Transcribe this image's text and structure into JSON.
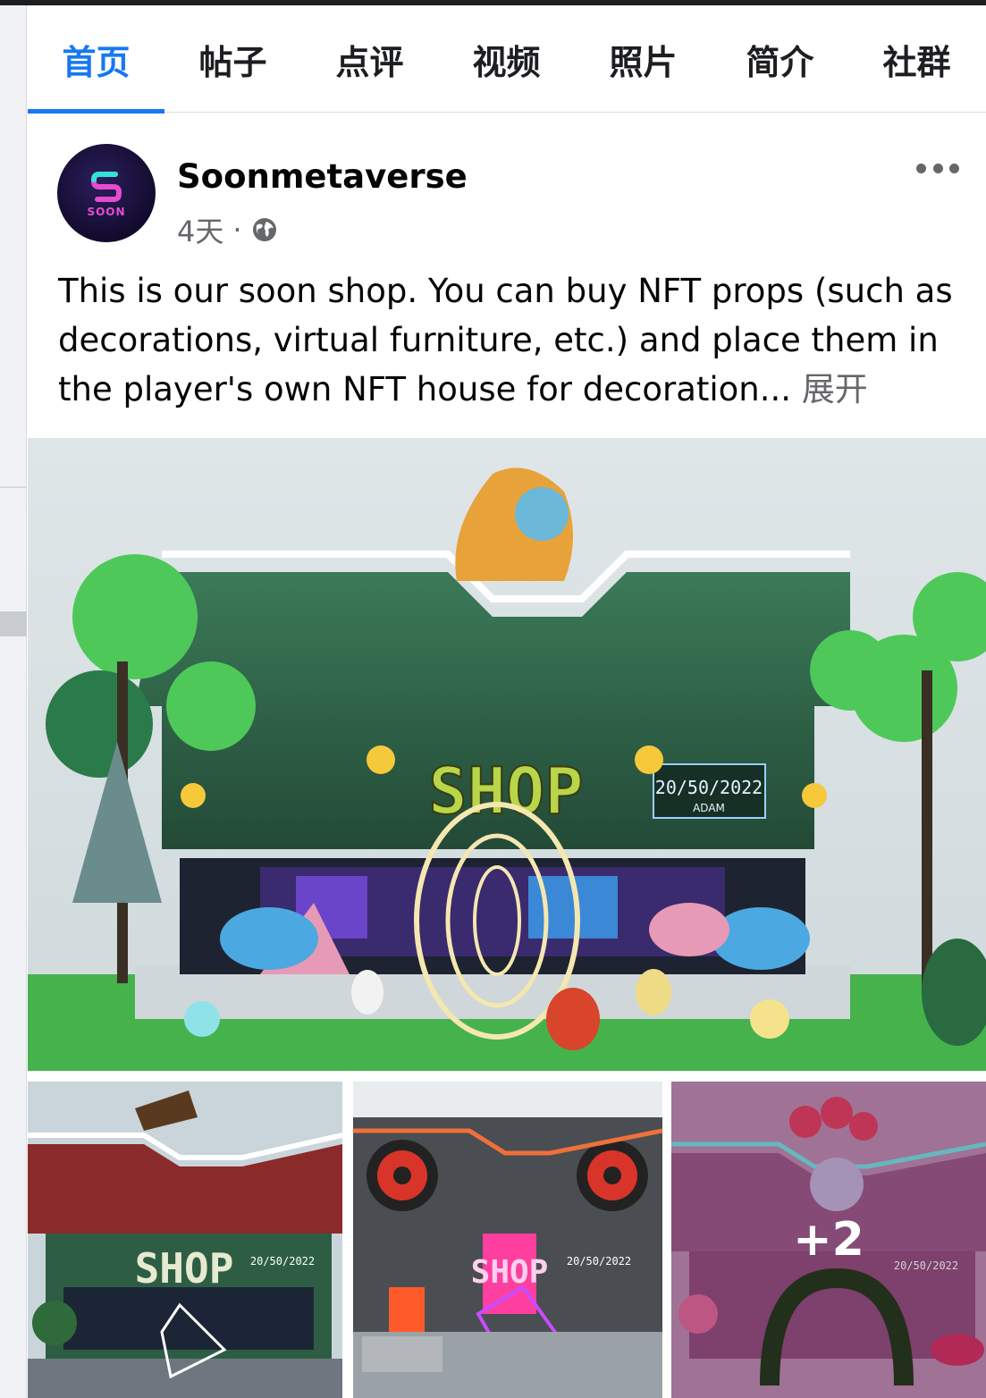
{
  "tabs": [
    {
      "label": "首页",
      "active": true
    },
    {
      "label": "帖子"
    },
    {
      "label": "点评"
    },
    {
      "label": "视频"
    },
    {
      "label": "照片"
    },
    {
      "label": "简介"
    },
    {
      "label": "社群"
    }
  ],
  "post": {
    "author": "Soonmetaverse",
    "avatar_text": "SOON",
    "time": "4天",
    "separator": "·",
    "privacy_icon": "globe-icon",
    "text": "This is our soon shop. You can buy NFT props (such as decorations, virtual furniture, etc.) and place them in the player's own NFT house for decoration...",
    "see_more": "展开"
  },
  "main_photo": {
    "sign_text": "SHOP",
    "screen_date": "20/50/2022",
    "screen_name": "ADAM"
  },
  "thumbnails": [
    {
      "sign": "SHOP",
      "date": "20/50/2022"
    },
    {
      "sign": "SHOP",
      "date": "20/50/2022"
    },
    {
      "sign": "",
      "date": "20/50/2022",
      "overlay": "+2"
    }
  ],
  "colors": {
    "accent": "#1877f2",
    "text": "#050505",
    "secondary": "#65676b",
    "shop_green": "#2e5e46"
  }
}
